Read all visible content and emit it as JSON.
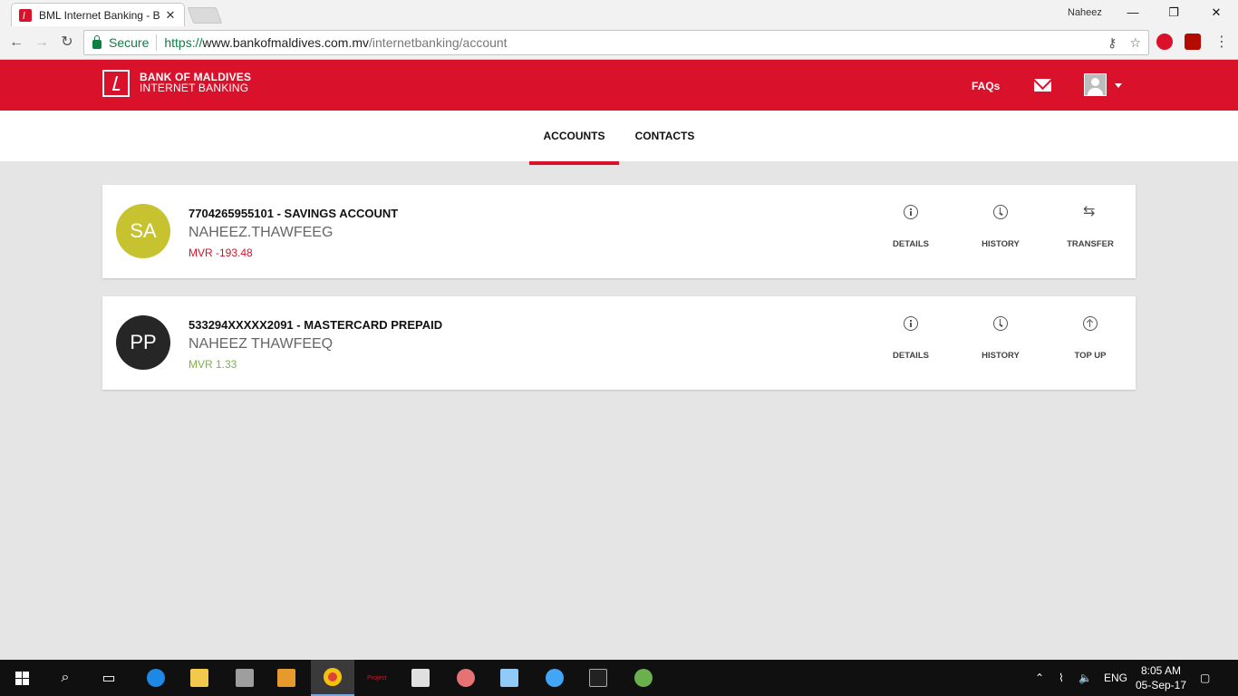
{
  "browser": {
    "tab_title": "BML Internet Banking - B",
    "profile_name": "Naheez",
    "secure_label": "Secure",
    "url_scheme": "https://",
    "url_host": "www.bankofmaldives.com.mv",
    "url_path": "/internetbanking/account"
  },
  "header": {
    "brand_line1": "BANK OF MALDIVES",
    "brand_line2": "INTERNET BANKING",
    "faqs": "FAQs",
    "brand_color": "#d9112a"
  },
  "subnav": {
    "tabs": [
      {
        "label": "ACCOUNTS",
        "active": true
      },
      {
        "label": "CONTACTS",
        "active": false
      }
    ]
  },
  "accounts": [
    {
      "initials": "SA",
      "avatar_color": "#c7c230",
      "title": "7704265955101 - SAVINGS ACCOUNT",
      "name": "NAHEEZ.THAWFEEG",
      "balance": "MVR -193.48",
      "balance_color": "#d9112a",
      "actions": [
        {
          "label": "DETAILS",
          "icon": "info-icon"
        },
        {
          "label": "HISTORY",
          "icon": "history-icon"
        },
        {
          "label": "TRANSFER",
          "icon": "transfer-icon"
        }
      ]
    },
    {
      "initials": "PP",
      "avatar_color": "#262626",
      "title": "533294XXXXX2091 - MASTERCARD PREPAID",
      "name": "NAHEEZ THAWFEEQ",
      "balance": "MVR 1.33",
      "balance_color": "#7cb342",
      "actions": [
        {
          "label": "DETAILS",
          "icon": "info-icon"
        },
        {
          "label": "HISTORY",
          "icon": "history-icon"
        },
        {
          "label": "TOP UP",
          "icon": "top-up-icon"
        }
      ]
    }
  ],
  "taskbar": {
    "language": "ENG",
    "time": "8:05 AM",
    "date": "05-Sep-17"
  }
}
